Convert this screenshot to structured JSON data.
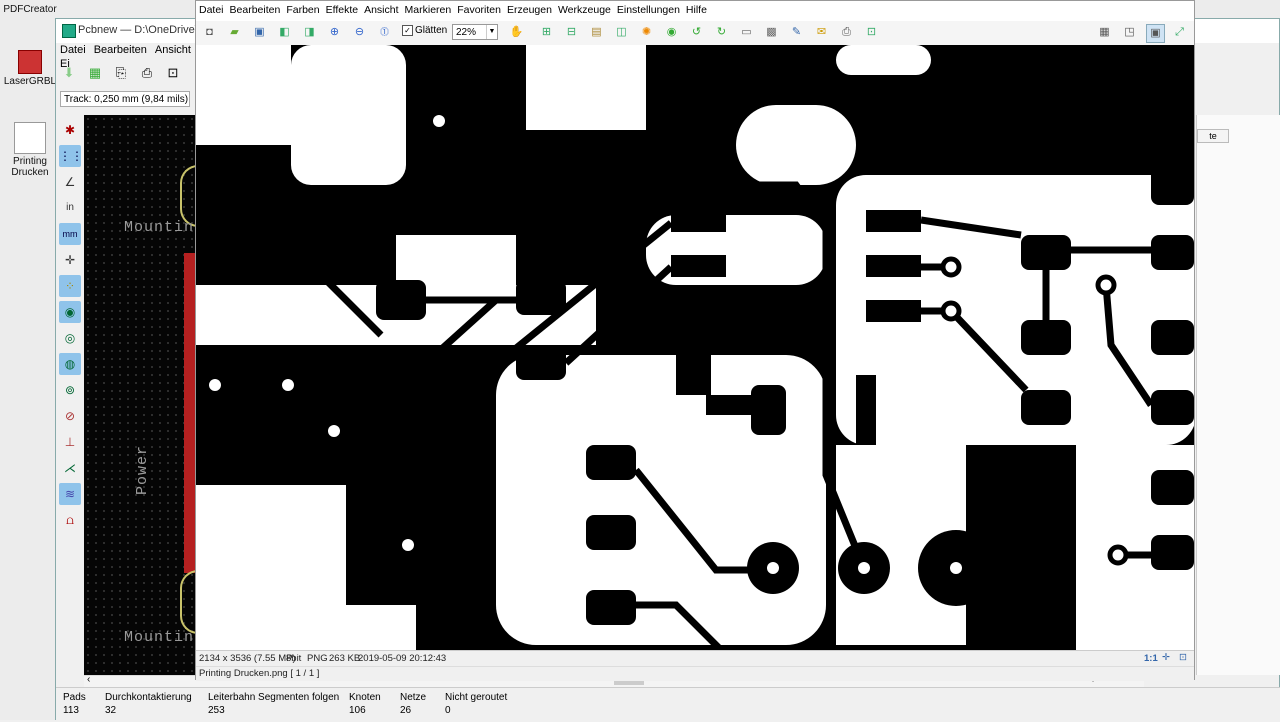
{
  "desktop": {
    "icons": [
      {
        "label": "PDFCreator"
      },
      {
        "label": "LaserGRBL"
      },
      {
        "label": "Printing Drucken"
      }
    ]
  },
  "pcbnew": {
    "title": "Pcbnew — D:\\OneDrive\\KiCa",
    "menu": [
      "Datei",
      "Bearbeiten",
      "Ansicht",
      "Ei"
    ],
    "track_selector": "Track: 0,250 mm (9,84 mils) *",
    "canvas_labels": {
      "mounting_top": "Mounting",
      "power": "Power",
      "mounting_bottom": "Mounting"
    },
    "right_tab": "te",
    "status": [
      {
        "label": "Pads",
        "value": "113"
      },
      {
        "label": "Durchkontaktierung",
        "value": "32"
      },
      {
        "label": "Leiterbahn Segmenten folgen",
        "value": "253"
      },
      {
        "label": "Knoten",
        "value": "106"
      },
      {
        "label": "Netze",
        "value": "26"
      },
      {
        "label": "Nicht geroutet",
        "value": "0"
      }
    ]
  },
  "viewer": {
    "menu": [
      "Datei",
      "Bearbeiten",
      "Farben",
      "Effekte",
      "Ansicht",
      "Markieren",
      "Favoriten",
      "Erzeugen",
      "Werkzeuge",
      "Einstellungen",
      "Hilfe"
    ],
    "smooth_label": "Glätten",
    "zoom": "22%",
    "status": {
      "dimensions": "2134 x 3536 (7.55 MP)",
      "depth": "8bit",
      "format": "PNG",
      "size": "263 KB",
      "date": "2019-05-09 20:12:43",
      "scale": "1:1",
      "filename": "Printing Drucken.png [ 1 / 1 ]"
    }
  },
  "colors": {
    "accent": "#8fc3ea",
    "pcb_copper": "#000000",
    "pcb_bg": "#ffffff"
  }
}
